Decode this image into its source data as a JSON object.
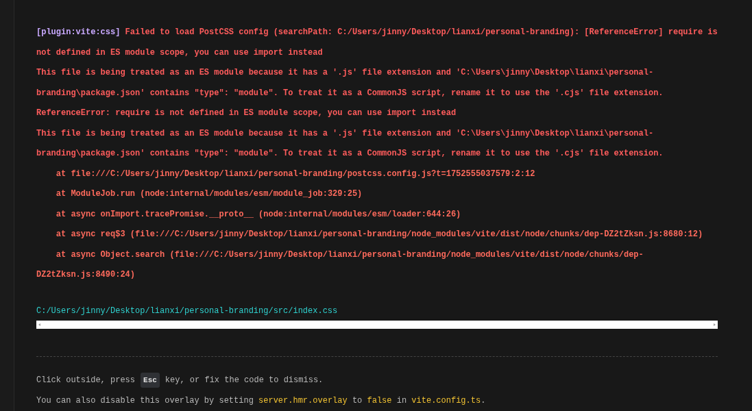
{
  "error": {
    "plugin": "[plugin:vite:css]",
    "message": "Failed to load PostCSS config (searchPath: C:/Users/jinny/Desktop/lianxi/personal-branding): [ReferenceError] require is not defined in ES module scope, you can use import instead\nThis file is being treated as an ES module because it has a '.js' file extension and 'C:\\Users\\jinny\\Desktop\\lianxi\\personal-branding\\package.json' contains \"type\": \"module\". To treat it as a CommonJS script, rename it to use the '.cjs' file extension.\nReferenceError: require is not defined in ES module scope, you can use import instead\nThis file is being treated as an ES module because it has a '.js' file extension and 'C:\\Users\\jinny\\Desktop\\lianxi\\personal-branding\\package.json' contains \"type\": \"module\". To treat it as a CommonJS script, rename it to use the '.cjs' file extension.",
    "stack": "    at file:///C:/Users/jinny/Desktop/lianxi/personal-branding/postcss.config.js?t=1752555037579:2:12\n    at ModuleJob.run (node:internal/modules/esm/module_job:329:25)\n    at async onImport.tracePromise.__proto__ (node:internal/modules/esm/loader:644:26)\n    at async req$3 (file:///C:/Users/jinny/Desktop/lianxi/personal-branding/node_modules/vite/dist/node/chunks/dep-DZ2tZksn.js:8680:12)\n    at async Object.search (file:///C:/Users/jinny/Desktop/lianxi/personal-branding/node_modules/vite/dist/node/chunks/dep-DZ2tZksn.js:8490:24)",
    "file": "C:/Users/jinny/Desktop/lianxi/personal-branding/src/index.css"
  },
  "tip": {
    "before_key": "Click outside, press",
    "key": "Esc",
    "after_key": "key, or fix the code to dismiss.",
    "note": [
      {
        "kind": "text",
        "text": "You can also disable this overlay by setting "
      },
      {
        "kind": "code",
        "text": "server.hmr.overlay"
      },
      {
        "kind": "text",
        "text": " to "
      },
      {
        "kind": "code",
        "text": "false"
      },
      {
        "kind": "text",
        "text": " in "
      },
      {
        "kind": "code",
        "text": "vite.config.ts"
      },
      {
        "kind": "text",
        "text": "."
      }
    ]
  }
}
